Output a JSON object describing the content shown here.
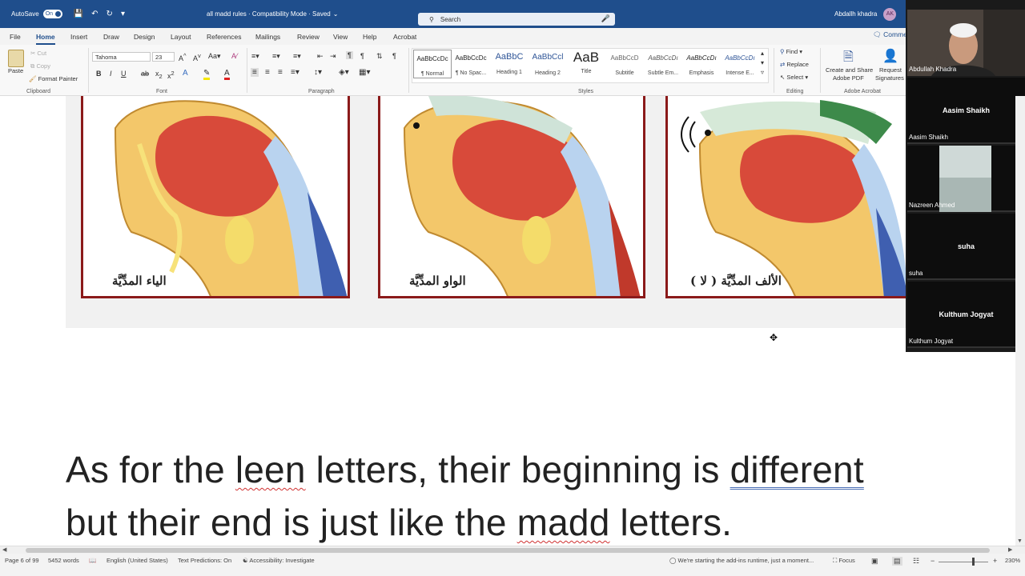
{
  "titlebar": {
    "autosave_label": "AutoSave",
    "autosave_state": "On",
    "doc_title": "all madd rules  ·  Compatibility Mode  ·  Saved",
    "search_placeholder": "Search",
    "user_name": "Abdallh khadra",
    "user_initials": "AK"
  },
  "menu": {
    "tabs": [
      "File",
      "Home",
      "Insert",
      "Draw",
      "Design",
      "Layout",
      "References",
      "Mailings",
      "Review",
      "View",
      "Help",
      "Acrobat"
    ],
    "active": "Home",
    "comments": "Comme"
  },
  "ribbon": {
    "clipboard": {
      "paste": "Paste",
      "cut": "Cut",
      "copy": "Copy",
      "format_painter": "Format Painter",
      "label": "Clipboard"
    },
    "font": {
      "name": "Tahoma",
      "size": "23",
      "label": "Font"
    },
    "paragraph": {
      "label": "Paragraph"
    },
    "styles": {
      "label": "Styles",
      "items": [
        {
          "sample": "AaBbCcDc",
          "name": "¶ Normal"
        },
        {
          "sample": "AaBbCcDc",
          "name": "¶ No Spac..."
        },
        {
          "sample": "AaBbC",
          "name": "Heading 1"
        },
        {
          "sample": "AaBbCcl",
          "name": "Heading 2"
        },
        {
          "sample": "AaB",
          "name": "Title"
        },
        {
          "sample": "AaBbCcD",
          "name": "Subtitle"
        },
        {
          "sample": "AaBbCcDı",
          "name": "Subtle Em..."
        },
        {
          "sample": "AaBbCcDı",
          "name": "Emphasis"
        },
        {
          "sample": "AaBbCcDı",
          "name": "Intense E..."
        }
      ]
    },
    "editing": {
      "find": "Find",
      "replace": "Replace",
      "select": "Select",
      "label": "Editing"
    },
    "acrobat": {
      "create_share": "Create and Share",
      "adobe_pdf": "Adobe PDF",
      "request": "Request",
      "signatures": "Signatures",
      "label": "Adobe Acrobat"
    }
  },
  "document": {
    "captions": [
      "الياء المدِّيَّة",
      "الواو المدِّيَّة",
      "الألف المدِّيَّة ( لا )"
    ],
    "line1_parts": [
      "As for the ",
      "leen",
      " letters, their beginning is ",
      "different"
    ],
    "line2_parts": [
      "but their end is just like the ",
      "madd",
      " letters."
    ]
  },
  "participants": [
    {
      "center": "",
      "corner": "Abdullah Khadra",
      "video": true
    },
    {
      "center": "Aasim Shaikh",
      "corner": "Aasim Shaikh",
      "video": false
    },
    {
      "center": "",
      "corner": "Nazreen Ahmed",
      "video": true
    },
    {
      "center": "suha",
      "corner": "suha",
      "video": false
    },
    {
      "center": "Kulthum Jogyat",
      "corner": "Kulthum Jogyat",
      "video": false
    }
  ],
  "status": {
    "page": "Page 6 of 99",
    "words": "5452 words",
    "language": "English (United States)",
    "predictions": "Text Predictions: On",
    "accessibility": "Accessibility: Investigate",
    "addins": "We're starting the add-ins runtime, just a moment...",
    "focus": "Focus",
    "zoom": "230%"
  }
}
